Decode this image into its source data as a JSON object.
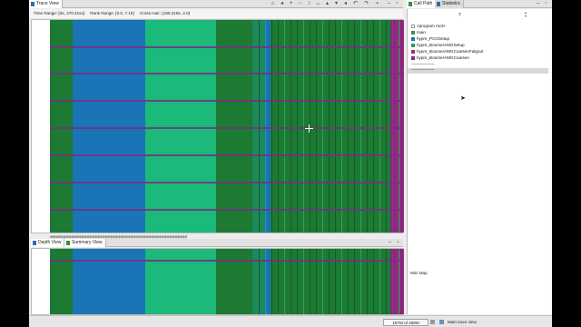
{
  "trace_tab": {
    "label": "Trace View"
  },
  "info": {
    "time_range": "Time Range: [0s, 270.311s]",
    "rank_range": "Rank Range: [0.0, 7.15]",
    "cross_hair": "Cross Hair: (180.215s, 4.0)"
  },
  "bottom_tabs": [
    {
      "label": "Depth View"
    },
    {
      "label": "Summary View"
    }
  ],
  "right_tabs": [
    {
      "label": "Call Path"
    },
    {
      "label": "Statistics"
    }
  ],
  "call_path": {
    "depth_value": "7",
    "items": [
      {
        "label": "<program root>",
        "color": "#ffffff"
      },
      {
        "label": "main",
        "color": "#3d8f42"
      },
      {
        "label": "hypre_PCGSetup",
        "color": "#1a74b5"
      },
      {
        "label": "hypre_BoomerAMGSetup",
        "color": "#1f9e77"
      },
      {
        "label": "hypre_BoomerAMGCoarsenFalgout",
        "color": "#b0236a"
      },
      {
        "label": "hypre_BoomerAMGCoarsen",
        "color": "#7a2d86"
      }
    ],
    "separator_1": "-------------------",
    "separator_2": "-------------------"
  },
  "minimap": {
    "label": "Mini Map"
  },
  "status": {
    "memory": "197M of 469M",
    "message": "Main trace view"
  },
  "colors": {
    "green": "#1c7a32",
    "blue": "#1a74b5",
    "teal": "#1bb97a",
    "purple": "#7a2d86",
    "magenta": "#c0246e"
  },
  "icons": [
    "trace-view-icon",
    "call-path-icon",
    "statistics-icon",
    "depth-view-icon",
    "summary-view-icon",
    "home-icon",
    "undo-icon",
    "redo-icon",
    "zoom-in-icon",
    "zoom-out-icon",
    "maximize-icon",
    "minimize-icon"
  ]
}
